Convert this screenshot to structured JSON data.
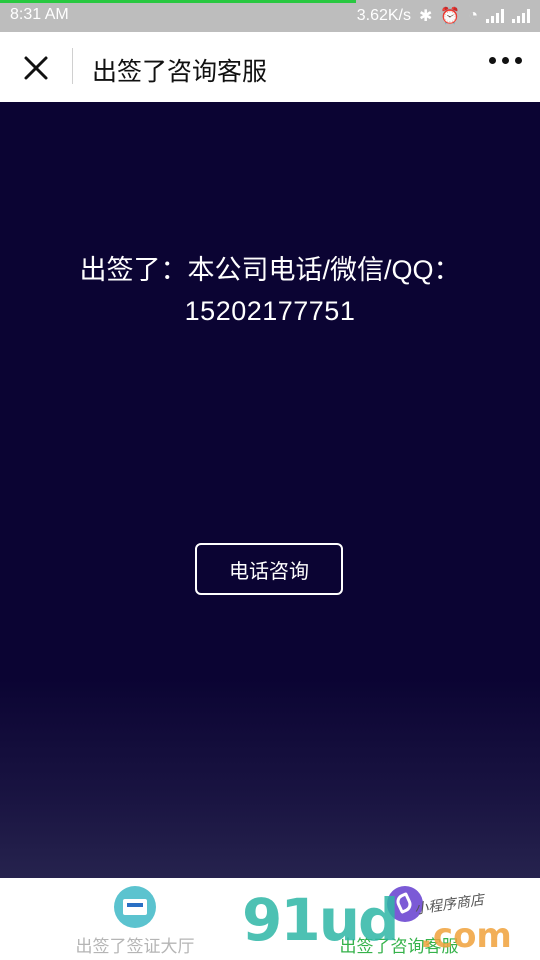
{
  "status_bar": {
    "time": "8:31 AM",
    "network_speed": "3.62K/s",
    "icons": [
      "bluetooth-icon",
      "alarm-icon",
      "wifi-icon",
      "signal-icon",
      "signal-icon"
    ],
    "page_load_progress": 0.66
  },
  "navbar": {
    "title": "出签了咨询客服",
    "close_icon": "close-icon",
    "more_icon": "more-icon"
  },
  "main": {
    "contact_line": "出签了：本公司电话/微信/QQ：",
    "phone_number": "15202177751",
    "call_button_label": "电话咨询"
  },
  "tabbar": {
    "tabs": [
      {
        "label": "出签了签证大厅",
        "icon": "visa-card-icon",
        "active": false
      },
      {
        "label": "出签了咨询客服",
        "icon": "phone-icon",
        "active": true
      }
    ]
  },
  "watermark": {
    "main_text": "91ud",
    "suffix": ".com",
    "tagline": "小程序商店"
  },
  "colors": {
    "background": "#0b0433",
    "active_tab": "#35b24a",
    "inactive_tab": "#b5b5b5"
  }
}
